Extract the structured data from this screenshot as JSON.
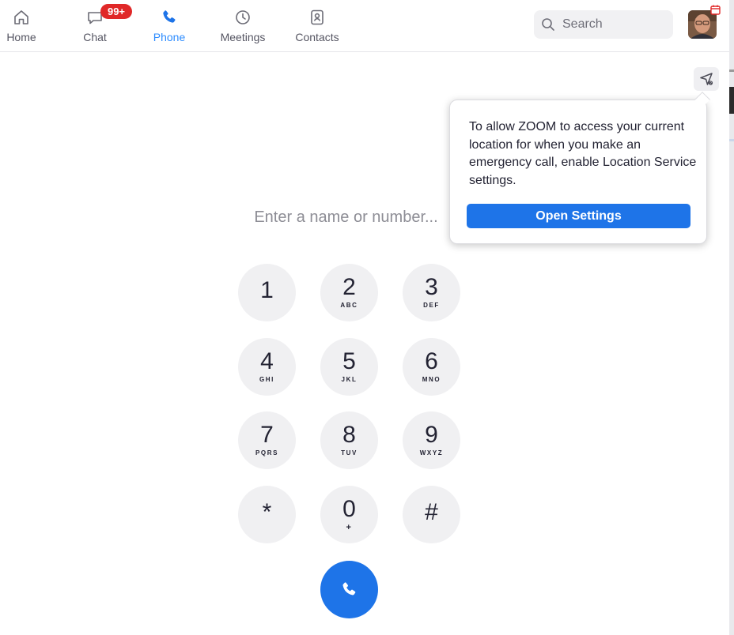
{
  "nav": {
    "items": [
      {
        "label": "Home",
        "icon": "home-icon"
      },
      {
        "label": "Chat",
        "icon": "chat-icon",
        "badge": "99+"
      },
      {
        "label": "Phone",
        "icon": "phone-icon",
        "active": true
      },
      {
        "label": "Meetings",
        "icon": "clock-icon"
      },
      {
        "label": "Contacts",
        "icon": "contact-card-icon"
      }
    ]
  },
  "search": {
    "placeholder": "Search",
    "icon": "search-icon"
  },
  "profile": {
    "icon": "avatar-photo",
    "status_icon": "calendar-icon"
  },
  "location_button": {
    "icon": "location-arrow-icon"
  },
  "popover": {
    "message": "To allow ZOOM to access your current location for when you make an emergency call, enable Location Service settings.",
    "button_label": "Open Settings"
  },
  "dialer": {
    "input_placeholder": "Enter a name or number...",
    "keys": [
      {
        "digit": "1",
        "letters": ""
      },
      {
        "digit": "2",
        "letters": "ABC"
      },
      {
        "digit": "3",
        "letters": "DEF"
      },
      {
        "digit": "4",
        "letters": "GHI"
      },
      {
        "digit": "5",
        "letters": "JKL"
      },
      {
        "digit": "6",
        "letters": "MNO"
      },
      {
        "digit": "7",
        "letters": "PQRS"
      },
      {
        "digit": "8",
        "letters": "TUV"
      },
      {
        "digit": "9",
        "letters": "WXYZ"
      },
      {
        "digit": "*",
        "letters": ""
      },
      {
        "digit": "0",
        "letters": "+"
      },
      {
        "digit": "#",
        "letters": ""
      }
    ],
    "call_icon": "phone-icon"
  },
  "colors": {
    "accent": "#1e74e8",
    "active_tab": "#2d8cff",
    "badge": "#e02828",
    "key_bg": "#f0f0f2"
  }
}
